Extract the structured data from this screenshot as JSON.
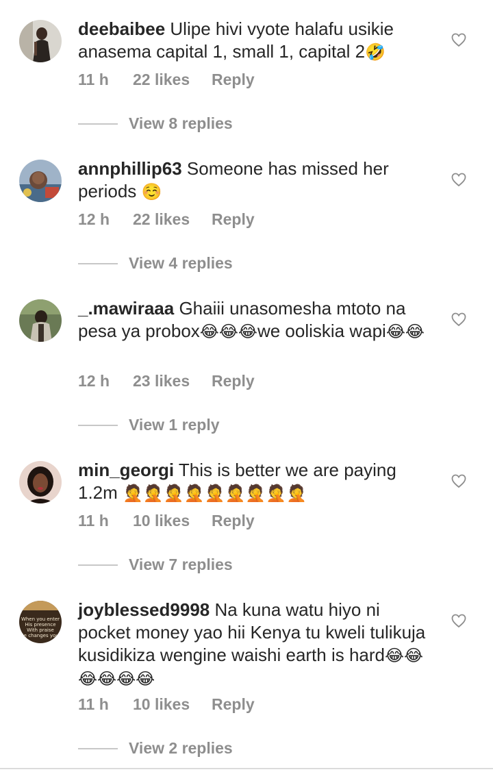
{
  "comments": [
    {
      "username": "deebaibee",
      "text": "Ulipe hivi vyote halafu usikie anasema capital 1, small 1, capital 2",
      "emoji": "🤣",
      "time": "11 h",
      "likes": "22 likes",
      "reply": "Reply",
      "view_replies": "View 8 replies"
    },
    {
      "username": "annphillip63",
      "text": "Someone has missed her periods",
      "emoji": "☺️",
      "time": "12 h",
      "likes": "22 likes",
      "reply": "Reply",
      "view_replies": "View 4 replies"
    },
    {
      "username": "_.mawiraaa",
      "text": "Ghaiii unasomesha mtoto na pesa ya probox",
      "emoji": "😂😂😂",
      "text2": "we ooliskia wapi",
      "emoji2": "😂😂",
      "time": "12 h",
      "likes": "23 likes",
      "reply": "Reply",
      "view_replies": "View 1 reply"
    },
    {
      "username": "min_georgi",
      "text": "This is better we are paying 1.2m",
      "emoji": "🤦🤦🤦🤦🤦🤦🤦🤦🤦",
      "time": "11 h",
      "likes": "10 likes",
      "reply": "Reply",
      "view_replies": "View 7 replies"
    },
    {
      "username": "joyblessed9998",
      "text": "Na kuna watu hiyo ni pocket money yao hii Kenya tu kweli tulikuja kusidikiza wengine waishi earth is hard",
      "emoji": "😂😂😂😂😂😂",
      "time": "11 h",
      "likes": "10 likes",
      "reply": "Reply",
      "view_replies": "View 2 replies"
    }
  ],
  "avatar_text": "When you enter His presence With praise He changes your circumstances",
  "icons": {
    "like": "heart-outline-icon"
  },
  "colors": {
    "text": "#262626",
    "meta": "#8e8e8e",
    "divider": "#c7c7c7"
  }
}
